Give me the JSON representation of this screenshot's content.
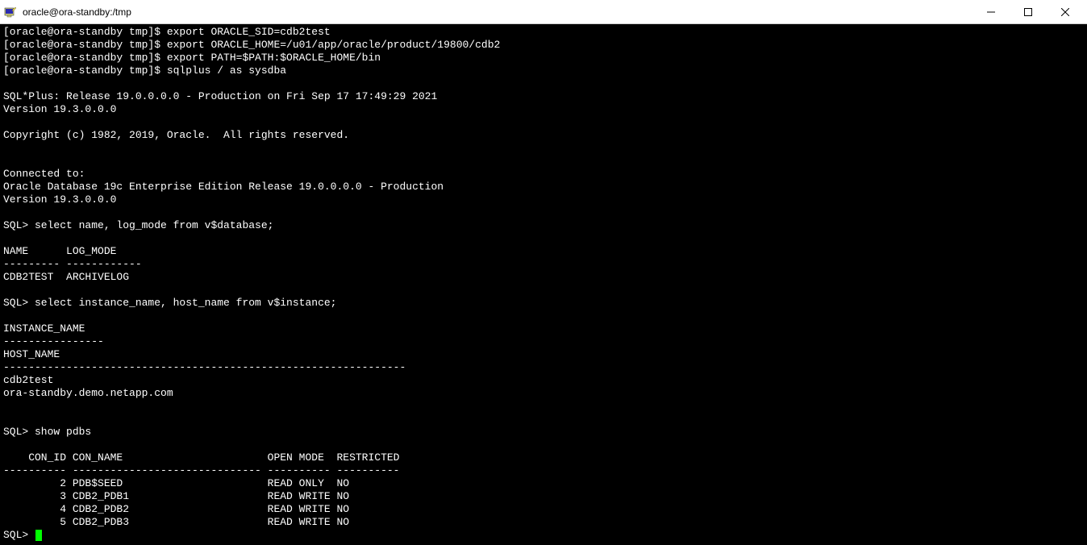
{
  "window": {
    "title": "oracle@ora-standby:/tmp"
  },
  "terminal": {
    "lines": [
      "[oracle@ora-standby tmp]$ export ORACLE_SID=cdb2test",
      "[oracle@ora-standby tmp]$ export ORACLE_HOME=/u01/app/oracle/product/19800/cdb2",
      "[oracle@ora-standby tmp]$ export PATH=$PATH:$ORACLE_HOME/bin",
      "[oracle@ora-standby tmp]$ sqlplus / as sysdba",
      "",
      "SQL*Plus: Release 19.0.0.0.0 - Production on Fri Sep 17 17:49:29 2021",
      "Version 19.3.0.0.0",
      "",
      "Copyright (c) 1982, 2019, Oracle.  All rights reserved.",
      "",
      "",
      "Connected to:",
      "Oracle Database 19c Enterprise Edition Release 19.0.0.0.0 - Production",
      "Version 19.3.0.0.0",
      "",
      "SQL> select name, log_mode from v$database;",
      "",
      "NAME      LOG_MODE",
      "--------- ------------",
      "CDB2TEST  ARCHIVELOG",
      "",
      "SQL> select instance_name, host_name from v$instance;",
      "",
      "INSTANCE_NAME",
      "----------------",
      "HOST_NAME",
      "----------------------------------------------------------------",
      "cdb2test",
      "ora-standby.demo.netapp.com",
      "",
      "",
      "SQL> show pdbs",
      "",
      "    CON_ID CON_NAME                       OPEN MODE  RESTRICTED",
      "---------- ------------------------------ ---------- ----------",
      "         2 PDB$SEED                       READ ONLY  NO",
      "         3 CDB2_PDB1                      READ WRITE NO",
      "         4 CDB2_PDB2                      READ WRITE NO",
      "         5 CDB2_PDB3                      READ WRITE NO"
    ],
    "prompt": "SQL> "
  }
}
